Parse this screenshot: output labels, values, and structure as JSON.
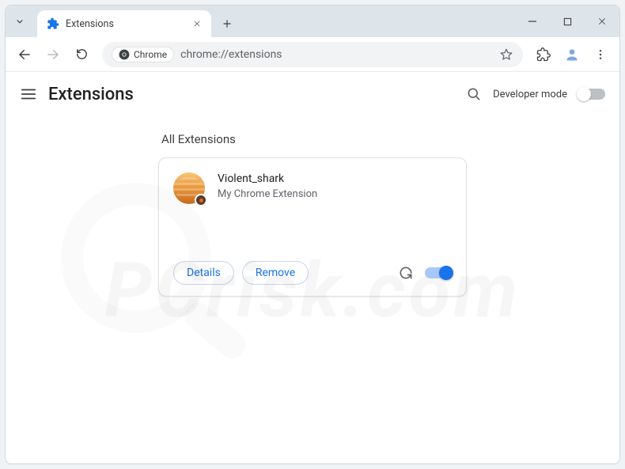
{
  "tab": {
    "title": "Extensions"
  },
  "omnibox": {
    "chip_label": "Chrome",
    "url": "chrome://extensions"
  },
  "header": {
    "title": "Extensions",
    "devmode_label": "Developer mode"
  },
  "section": {
    "label": "All Extensions"
  },
  "extension": {
    "name": "Violent_shark",
    "description": "My Chrome Extension",
    "details_label": "Details",
    "remove_label": "Remove",
    "enabled": true
  },
  "watermark": "PCrisk.com"
}
